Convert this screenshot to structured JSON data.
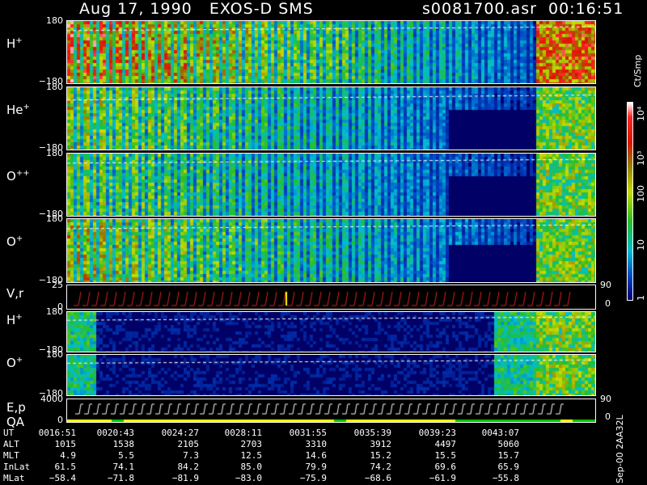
{
  "header": {
    "left": "Aug 17, 1990   EXOS-D SMS",
    "right": "s0081700.asr  00:16:51"
  },
  "panels": [
    {
      "id": "h_plus_1",
      "label": "H",
      "sup": "+",
      "ymax": "180",
      "ymin": "−180",
      "bright": 0.85,
      "dashed": 0.15
    },
    {
      "id": "he_plus",
      "label": "He",
      "sup": "+",
      "ymax": "180",
      "ymin": "−180",
      "bright": 0.6,
      "dashed": 0.2
    },
    {
      "id": "o_pp",
      "label": "O",
      "sup": "++",
      "ymax": "180",
      "ymin": "−180",
      "bright": 0.55,
      "dashed": 0.15
    },
    {
      "id": "o_plus_1",
      "label": "O",
      "sup": "+",
      "ymax": "180",
      "ymin": "−180",
      "bright": 0.65,
      "dashed": 0.15
    },
    {
      "id": "vr",
      "label": "V,r",
      "sup": "",
      "ymax": "25",
      "ymin": "0",
      "right_top": "90",
      "right_bottom": "0"
    },
    {
      "id": "h_plus_2",
      "label": "H",
      "sup": "+",
      "ymax": "180",
      "ymin": "−180",
      "bright": 0.15,
      "dashed": 0.2
    },
    {
      "id": "o_plus_2",
      "label": "O",
      "sup": "+",
      "ymax": "180",
      "ymin": "−180",
      "bright": 0.15,
      "dashed": 0.2
    },
    {
      "id": "ep",
      "label": "E,p",
      "label2": "QA",
      "ymax": "4000",
      "ymin": "0",
      "right_top": "90",
      "right_bottom": "0"
    }
  ],
  "colorbar": {
    "unit": "Ct/Smp",
    "labels": [
      "1",
      "10",
      "100",
      "10³",
      "10⁴"
    ]
  },
  "footer": {
    "rows": [
      {
        "label": "UT",
        "values": [
          "0016:51",
          "0020:43",
          "0024:27",
          "0028:11",
          "0031:55",
          "0035:39",
          "0039:23",
          "0043:07"
        ]
      },
      {
        "label": "ALT",
        "values": [
          "1015",
          "1538",
          "2105",
          "2703",
          "3310",
          "3912",
          "4497",
          "5060"
        ]
      },
      {
        "label": "MLT",
        "values": [
          "4.9",
          "5.5",
          "7.3",
          "12.5",
          "14.6",
          "15.2",
          "15.5",
          "15.7"
        ]
      },
      {
        "label": "InLat",
        "values": [
          "61.5",
          "74.1",
          "84.2",
          "85.0",
          "79.9",
          "74.2",
          "69.6",
          "65.9"
        ]
      },
      {
        "label": "MLat",
        "values": [
          "−58.4",
          "−71.8",
          "−81.9",
          "−83.0",
          "−75.9",
          "−68.6",
          "−61.9",
          "−55.8"
        ]
      }
    ]
  },
  "sidenote": "Sep-00 2AA32L",
  "chart_data": {
    "type": "heatmap",
    "title": "Aug 17, 1990   EXOS-D SMS",
    "x_ticks": [
      "0016:51",
      "0020:43",
      "0024:27",
      "0028:11",
      "0031:55",
      "0035:39",
      "0039:23",
      "0043:07"
    ],
    "panels": [
      "H+",
      "He+",
      "O++",
      "O+",
      "V,r",
      "H+",
      "O+",
      "E,p"
    ],
    "yrange_pitch": [
      -180,
      180
    ],
    "colorbar_range": [
      1,
      10000
    ],
    "colorbar_scale": "log",
    "colorbar_unit": "Ct/Smp"
  }
}
